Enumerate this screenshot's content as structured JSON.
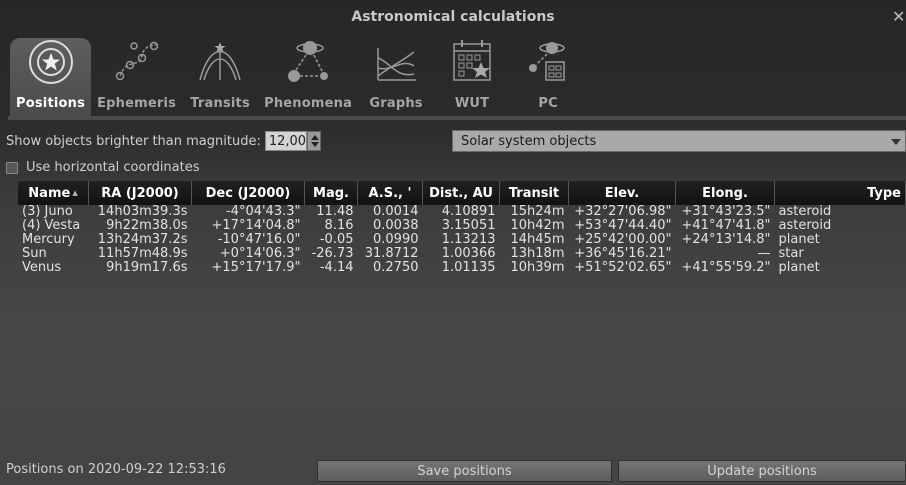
{
  "window": {
    "title": "Astronomical calculations",
    "close_glyph": "✕"
  },
  "tabs": [
    {
      "label": "Positions",
      "icon": "positions-icon",
      "active": true
    },
    {
      "label": "Ephemeris",
      "icon": "ephemeris-icon",
      "active": false
    },
    {
      "label": "Transits",
      "icon": "transits-icon",
      "active": false
    },
    {
      "label": "Phenomena",
      "icon": "phenomena-icon",
      "active": false
    },
    {
      "label": "Graphs",
      "icon": "graphs-icon",
      "active": false
    },
    {
      "label": "WUT",
      "icon": "wut-icon",
      "active": false
    },
    {
      "label": "PC",
      "icon": "pc-icon",
      "active": false
    }
  ],
  "filters": {
    "magnitude_label": "Show objects brighter than magnitude:",
    "magnitude_value": "12,00",
    "object_type": "Solar system objects",
    "horizontal_label": "Use horizontal coordinates",
    "horizontal_checked": false
  },
  "table": {
    "headers": [
      "Name",
      "RA (J2000)",
      "Dec (J2000)",
      "Mag.",
      "A.S., '",
      "Dist., AU",
      "Transit",
      "Elev.",
      "Elong.",
      "Type"
    ],
    "rows": [
      [
        "(3) Juno",
        "14h03m39.3s",
        "-4°04'43.3\"",
        "11.48",
        "0.0014",
        "4.10891",
        "15h24m",
        "+32°27'06.98\"",
        "+31°43'23.5\"",
        "asteroid"
      ],
      [
        "(4) Vesta",
        "9h22m38.0s",
        "+17°14'04.8\"",
        "8.16",
        "0.0038",
        "3.15051",
        "10h42m",
        "+53°47'44.40\"",
        "+41°47'41.8\"",
        "asteroid"
      ],
      [
        "Mercury",
        "13h24m37.2s",
        "-10°47'16.0\"",
        "-0.05",
        "0.0990",
        "1.13213",
        "14h45m",
        "+25°42'00.00\"",
        "+24°13'14.8\"",
        "planet"
      ],
      [
        "Sun",
        "11h57m48.9s",
        "+0°14'06.3\"",
        "-26.73",
        "31.8712",
        "1.00366",
        "13h18m",
        "+36°45'16.21\"",
        "—",
        "star"
      ],
      [
        "Venus",
        "9h19m17.6s",
        "+15°17'17.9\"",
        "-4.14",
        "0.2750",
        "1.01135",
        "10h39m",
        "+51°52'02.65\"",
        "+41°55'59.2\"",
        "planet"
      ]
    ]
  },
  "status": {
    "text": "Positions on 2020-09-22 12:53:16",
    "save_label": "Save positions",
    "update_label": "Update positions"
  }
}
